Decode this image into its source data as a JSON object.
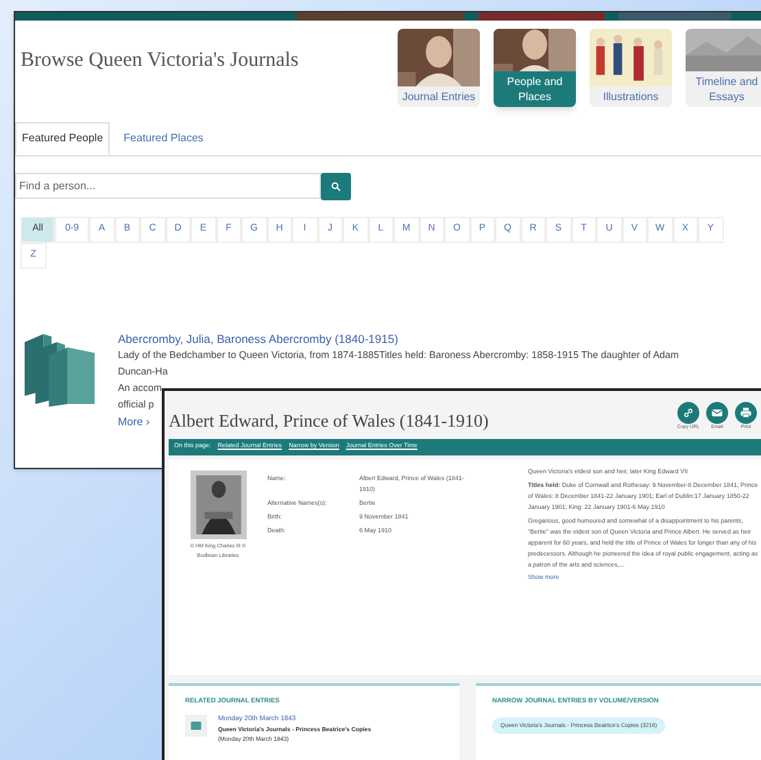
{
  "browse_window": {
    "title": "Browse Queen Victoria's Journals",
    "nav": [
      {
        "label": "Journal Entries",
        "selected": false,
        "kind": "portrait"
      },
      {
        "label": "People and Places",
        "selected": true,
        "kind": "portrait"
      },
      {
        "label": "Illustrations",
        "selected": false,
        "kind": "figures"
      },
      {
        "label": "Timeline and Essays",
        "selected": false,
        "kind": "sketch"
      }
    ],
    "tabs": [
      {
        "label": "Featured People",
        "selected": true
      },
      {
        "label": "Featured Places",
        "selected": false
      }
    ],
    "search": {
      "placeholder": "Find a person..."
    },
    "letters": [
      {
        "label": "All",
        "selected": true
      },
      {
        "label": "0-9",
        "selected": false
      },
      {
        "label": "A",
        "selected": false
      },
      {
        "label": "B",
        "selected": false
      },
      {
        "label": "C",
        "selected": false
      },
      {
        "label": "D",
        "selected": false
      },
      {
        "label": "E",
        "selected": false
      },
      {
        "label": "F",
        "selected": false
      },
      {
        "label": "G",
        "selected": false
      },
      {
        "label": "H",
        "selected": false
      },
      {
        "label": "I",
        "selected": false
      },
      {
        "label": "J",
        "selected": false
      },
      {
        "label": "K",
        "selected": false
      },
      {
        "label": "L",
        "selected": false
      },
      {
        "label": "M",
        "selected": false
      },
      {
        "label": "N",
        "selected": false
      },
      {
        "label": "O",
        "selected": false
      },
      {
        "label": "P",
        "selected": false
      },
      {
        "label": "Q",
        "selected": false
      },
      {
        "label": "R",
        "selected": false
      },
      {
        "label": "S",
        "selected": false
      },
      {
        "label": "T",
        "selected": false
      },
      {
        "label": "U",
        "selected": false
      },
      {
        "label": "V",
        "selected": false
      },
      {
        "label": "W",
        "selected": false
      },
      {
        "label": "X",
        "selected": false
      },
      {
        "label": "Y",
        "selected": false
      },
      {
        "label": "Z",
        "selected": false
      }
    ],
    "entry": {
      "title": "Abercromby, Julia, Baroness Abercromby (1840-1915)",
      "lines": [
        "Lady of the Bedchamber to Queen Victoria, from 1874-1885Titles held: Baroness Abercromby: 1858-1915 The daughter of Adam",
        "Duncan-Ha",
        "An accom",
        "official p"
      ],
      "more": "More ›"
    }
  },
  "detail_window": {
    "title": "Albert Edward, Prince of Wales (1841-1910)",
    "actions": [
      {
        "label": "Copy URL",
        "kind": "link"
      },
      {
        "label": "Email",
        "kind": "mail"
      },
      {
        "label": "Print",
        "kind": "print"
      }
    ],
    "on_this_page": {
      "label": "On this page:",
      "links": [
        "Related Journal Entries",
        "Narrow by Version",
        "Journal Entries Over Time"
      ]
    },
    "caption": "© HM King Charles III © Bodleian Libraries",
    "fields": [
      {
        "label": "Name:",
        "value": "Albert Edward, Prince of Wales (1841-1910)"
      },
      {
        "label": "Alternative Names(s):",
        "value": "Bertie"
      },
      {
        "label": "Birth:",
        "value": "9 November 1841"
      },
      {
        "label": "Death:",
        "value": "6 May 1910"
      }
    ],
    "summary": "Queen Victoria's eldest son and heir, later King Edward VII",
    "titles": "**Titles held:** Duke of Cornwall and Rothesay: 9 November-8 December 1841; Prince of Wales: 8 December 1841-22 January 1901; Earl of Dublin:17 January 1850-22 January 1901; King: 22 January 1901-6 May 1910",
    "description": "Gregarious, good humoured and somewhat of a disappointment to his parents, \"Bertie\" was the eldest son of Queen Victoria and Prince Albert. He served as heir apparent for 60 years, and held the title of Prince of Wales for longer than any of his predecessors. Although he pioneered the idea of royal public engagement, acting as a patron of the arts and sciences,...",
    "show_more": "Show more",
    "related": {
      "heading": "RELATED JOURNAL ENTRIES",
      "entries": [
        {
          "date": "Monday 20th March 1843",
          "text": "**Queen Victoria's Journals - Princess Beatrice's Copies** (Monday 20th March 1843)"
        }
      ]
    },
    "narrow": {
      "heading": "NARROW JOURNAL ENTRIES BY VOLUME/VERSION",
      "chips": [
        "Queen Victoria's Journals - Princess Beatrice's Copies (3216)"
      ]
    }
  }
}
